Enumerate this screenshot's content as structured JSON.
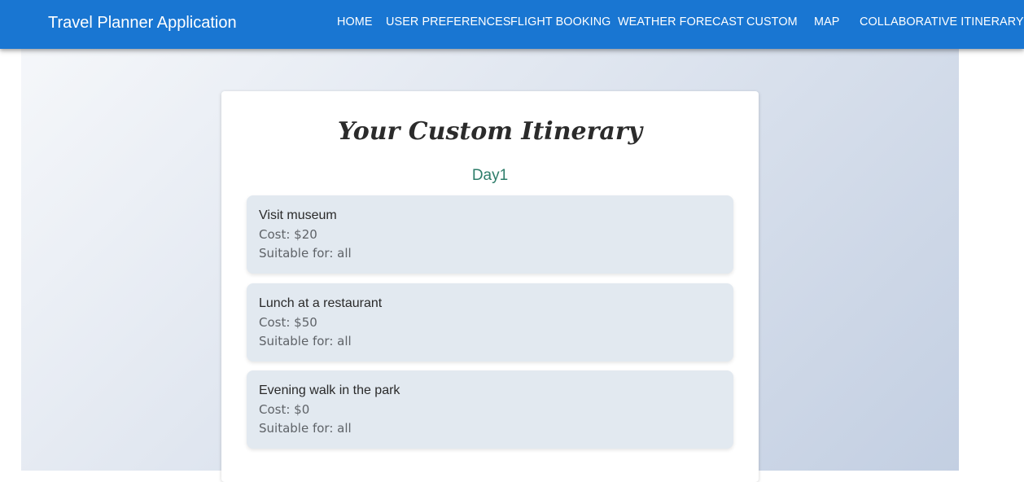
{
  "header": {
    "title": "Travel Planner Application",
    "nav": [
      {
        "label": "HOME"
      },
      {
        "label": "USER PREFERENCES"
      },
      {
        "label": "FLIGHT BOOKING"
      },
      {
        "label": "WEATHER FORECAST"
      },
      {
        "label": "CUSTOM"
      },
      {
        "label": "MAP"
      },
      {
        "label": "COLLABORATIVE ITINERARY"
      }
    ]
  },
  "itinerary": {
    "title": "Your Custom Itinerary",
    "day": "Day1",
    "activities": [
      {
        "name": "Visit museum",
        "cost": "Cost: $20",
        "suitable": "Suitable for: all"
      },
      {
        "name": "Lunch at a restaurant",
        "cost": "Cost: $50",
        "suitable": "Suitable for: all"
      },
      {
        "name": "Evening walk in the park",
        "cost": "Cost: $0",
        "suitable": "Suitable for: all"
      }
    ]
  },
  "colors": {
    "appbar": "#1976d2",
    "day_label": "#2e7d6a",
    "activity_card": "#e2e9f0"
  }
}
